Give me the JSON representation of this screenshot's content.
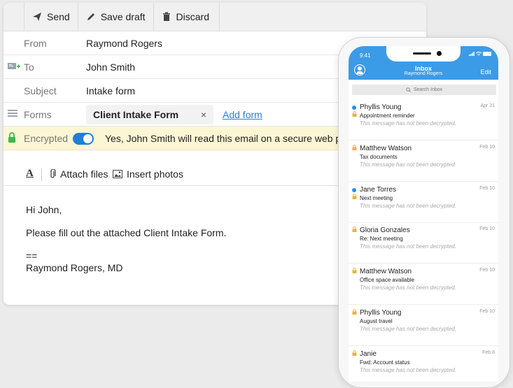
{
  "toolbar": {
    "send": "Send",
    "save_draft": "Save draft",
    "discard": "Discard"
  },
  "fields": {
    "from_label": "From",
    "from_value": "Raymond Rogers",
    "to_label": "To",
    "to_value": "John Smith",
    "subject_label": "Subject",
    "subject_value": "Intake form",
    "forms_label": "Forms",
    "form_chip": "Client Intake Form",
    "chip_remove": "×",
    "add_form": "Add form",
    "encrypted_label": "Encrypted",
    "encrypted_message": "Yes, John Smith will read this email on a secure web pa"
  },
  "format_bar": {
    "font": "A",
    "attach": "Attach files",
    "insert_photos": "Insert photos"
  },
  "body": {
    "greeting": "Hi John,",
    "line1": "Please fill out the attached Client Intake Form.",
    "sig_sep": "==",
    "signature": "Raymond Rogers, MD"
  },
  "phone": {
    "time": "9:41",
    "title": "Inbox",
    "subtitle": "Raymond Rogers",
    "edit": "Edit",
    "search_placeholder": "Search Inbox",
    "messages": [
      {
        "sender": "Phyllis Young",
        "subject": "Appointment reminder",
        "preview": "This message has not been decrypted.",
        "date": "Apr 21",
        "unread": true
      },
      {
        "sender": "Matthew Watson",
        "subject": "Tax documents",
        "preview": "This message has not been decrypted.",
        "date": "Feb 10",
        "unread": false
      },
      {
        "sender": "Jane Torres",
        "subject": "Next meeting",
        "preview": "This message has not been decrypted.",
        "date": "Feb 10",
        "unread": true
      },
      {
        "sender": "Gloria Gonzales",
        "subject": "Re: Next meeting",
        "preview": "This message has not been decrypted.",
        "date": "Feb 10",
        "unread": false
      },
      {
        "sender": "Matthew Watson",
        "subject": "Office space available",
        "preview": "This message has not been decrypted.",
        "date": "Feb 10",
        "unread": false
      },
      {
        "sender": "Phyllis Young",
        "subject": "August travel",
        "preview": "This message has not been decrypted.",
        "date": "Feb 10",
        "unread": false
      },
      {
        "sender": "Janie",
        "subject": "Fwd: Account status",
        "preview": "This message has not been decrypted.",
        "date": "Feb 8",
        "unread": false
      }
    ]
  },
  "colors": {
    "accent": "#1f7fd9",
    "header_blue": "#3c9be6",
    "encrypted_bg": "#fdf6d4",
    "lock_green": "#3db84a",
    "lock_gold": "#e8b43c"
  }
}
